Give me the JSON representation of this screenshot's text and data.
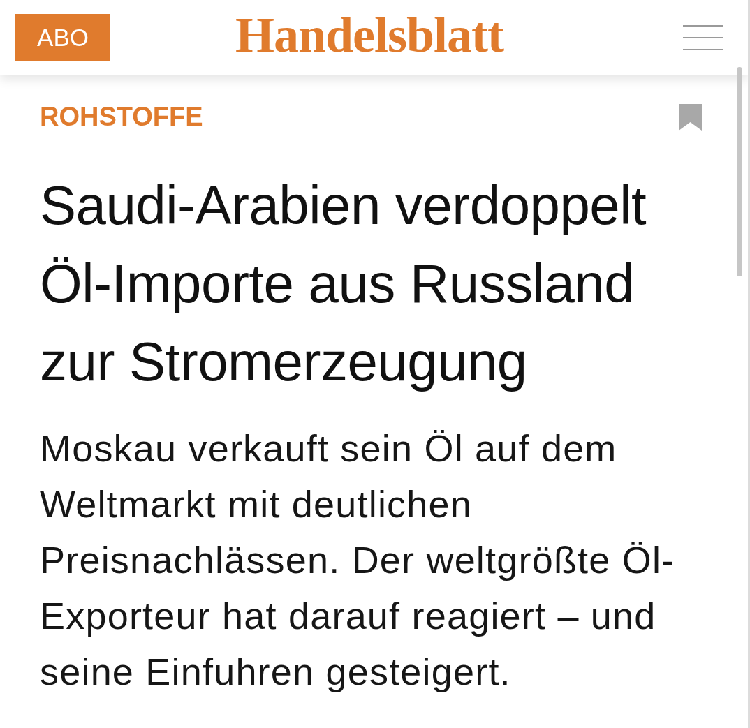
{
  "header": {
    "subscribe_button": "ABO",
    "logo": "Handelsblatt"
  },
  "article": {
    "category": "ROHSTOFFE",
    "headline": "Saudi-Arabien verdoppelt Öl-Importe aus Russland zur Stromerzeugung",
    "teaser": "Moskau verkauft sein Öl auf dem Weltmarkt mit deutlichen Preisnachlässen. Der weltgrößte Öl-Exporteur hat darauf reagiert – und seine Einfuhren gesteigert."
  }
}
